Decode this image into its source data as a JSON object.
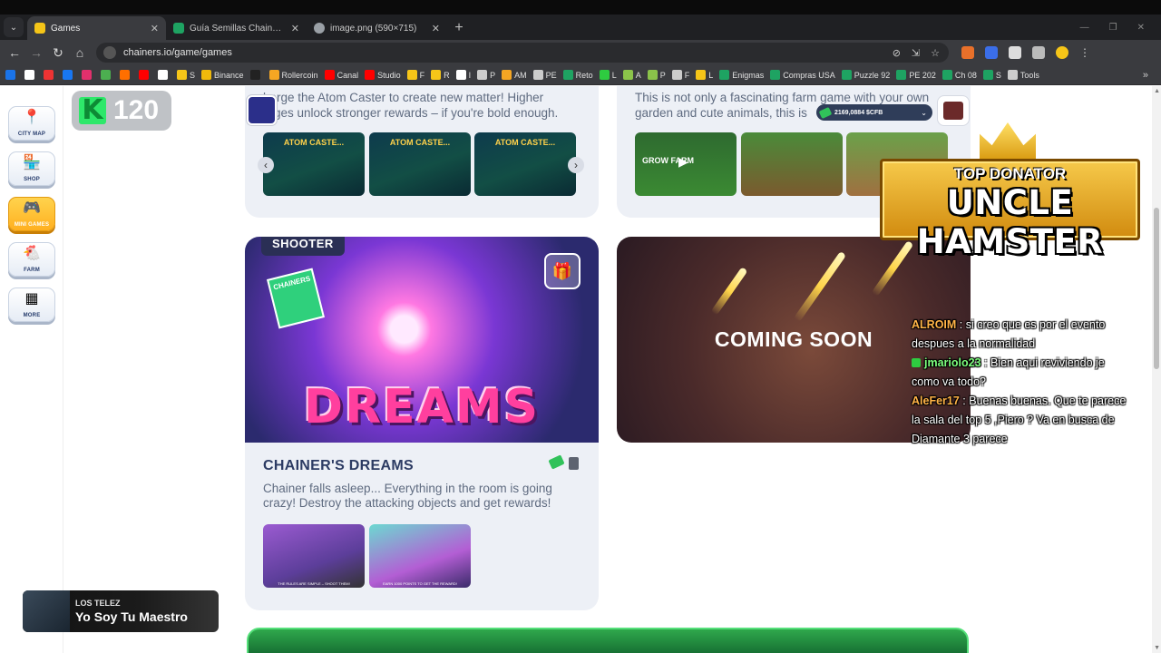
{
  "browser": {
    "tabs": [
      {
        "label": "Games",
        "active": true,
        "favicon_color": "#f5c518"
      },
      {
        "label": "Guía Semillas Chainers by Piero",
        "active": false,
        "favicon_color": "#1ea362"
      },
      {
        "label": "image.png (590×715)",
        "active": false,
        "favicon_color": "#9aa0a6"
      }
    ],
    "url": "chainers.io/game/games",
    "bookmarks": [
      {
        "label": "",
        "color": "#1a73e8"
      },
      {
        "label": "",
        "color": "#fff"
      },
      {
        "label": "",
        "color": "#e33"
      },
      {
        "label": "",
        "color": "#1877f2"
      },
      {
        "label": "",
        "color": "#e1306c"
      },
      {
        "label": "",
        "color": "#4caf50"
      },
      {
        "label": "",
        "color": "#ff6f00"
      },
      {
        "label": "",
        "color": "#ff0000"
      },
      {
        "label": "",
        "color": "#fff"
      },
      {
        "label": "S",
        "color": "#f5c518"
      },
      {
        "label": "Binance",
        "color": "#f0b90b"
      },
      {
        "label": "",
        "color": "#222"
      },
      {
        "label": "Rollercoin",
        "color": "#f5a623"
      },
      {
        "label": "Canal",
        "color": "#ff0000"
      },
      {
        "label": "Studio",
        "color": "#ff0000"
      },
      {
        "label": "F",
        "color": "#f5c518"
      },
      {
        "label": "R",
        "color": "#f5c518"
      },
      {
        "label": "I",
        "color": "#fff"
      },
      {
        "label": "P",
        "color": "#ccc"
      },
      {
        "label": "AM",
        "color": "#f5a623"
      },
      {
        "label": "PE",
        "color": "#ccc"
      },
      {
        "label": "Reto",
        "color": "#1ea362"
      },
      {
        "label": "L",
        "color": "#2ecc40"
      },
      {
        "label": "A",
        "color": "#8bc34a"
      },
      {
        "label": "P",
        "color": "#8bc34a"
      },
      {
        "label": "F",
        "color": "#ccc"
      },
      {
        "label": "L",
        "color": "#f5c518"
      },
      {
        "label": "Enigmas",
        "color": "#1ea362"
      },
      {
        "label": "Compras USA",
        "color": "#1ea362"
      },
      {
        "label": "Puzzle 92",
        "color": "#1ea362"
      },
      {
        "label": "PE 202",
        "color": "#1ea362"
      },
      {
        "label": "Ch 08",
        "color": "#1ea362"
      },
      {
        "label": "S",
        "color": "#1ea362"
      },
      {
        "label": "Tools",
        "color": "#ccc"
      }
    ]
  },
  "sidebar": {
    "items": [
      {
        "label": "CITY MAP",
        "icon": "map-pin-icon",
        "active": false
      },
      {
        "label": "SHOP",
        "icon": "shop-icon",
        "active": false
      },
      {
        "label": "MINI GAMES",
        "icon": "gamepad-icon",
        "active": true
      },
      {
        "label": "FARM",
        "icon": "chicken-icon",
        "active": false
      },
      {
        "label": "MORE",
        "icon": "grid-icon",
        "active": false
      }
    ]
  },
  "k_badge": {
    "value": "120"
  },
  "top_cards": {
    "left": {
      "text": "harge the Atom Caster to create new matter! Higher\narges unlock stronger rewards – if you're bold enough.",
      "thumbs": [
        "ATOM CASTE...",
        "ATOM CASTE...",
        "ATOM CASTE..."
      ]
    },
    "right": {
      "text": "This is not only a fascinating farm game with your own\ngarden and cute animals, this is",
      "thumbs": [
        "GROW FARM",
        "",
        ""
      ]
    }
  },
  "balance": {
    "value": "2169,0884 $CFB"
  },
  "shooter_card": {
    "tag": "SHOOTER",
    "art_title": "DREAMS",
    "art_badge": "CHAINERS",
    "title": "CHAINER'S DREAMS",
    "description": "Chainer falls asleep... Everything in the room is going crazy! Destroy the attacking objects and get rewards!",
    "thumbs": [
      "THE RULES ARE SIMPLE – SHOOT THEM!",
      "EARN 1000 POINTS TO GET THE REWARD!"
    ]
  },
  "coming_card": {
    "text": "COMING SOON"
  },
  "donator": {
    "subtitle": "TOP DONATOR",
    "name": "UNCLE HAMSTER"
  },
  "chat": [
    {
      "user": "ALROIM",
      "user_color": "orange",
      "badge": false,
      "message": "si creo que es por el evento despues a la normalidad"
    },
    {
      "user": "jmariolo23",
      "user_color": "green",
      "badge": true,
      "message": "Bien aqui reviviendo je como va todo?"
    },
    {
      "user": "AleFer17",
      "user_color": "orange",
      "badge": false,
      "message": "Buenas buenas. Que te parece la sala del top 5 ,Piero ? Va en busca de Diamante 3 parece"
    }
  ],
  "music": {
    "artist": "LOS TELEZ",
    "song": "Yo Soy Tu Maestro"
  }
}
